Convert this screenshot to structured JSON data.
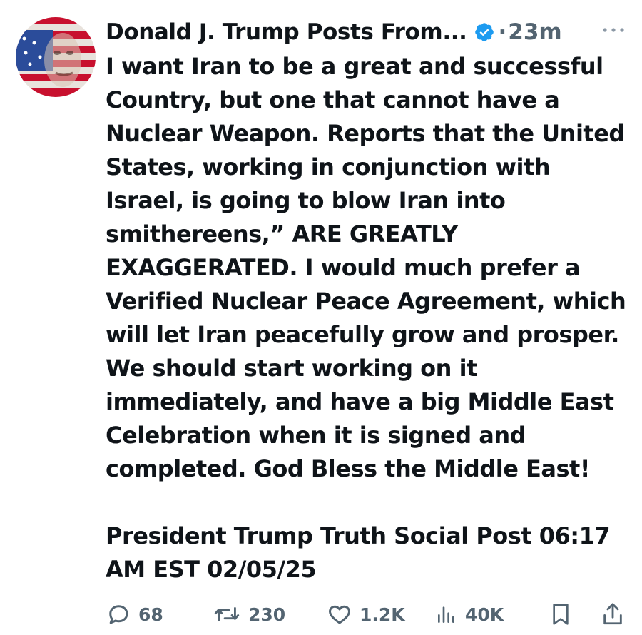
{
  "post": {
    "author": "Donald J. Trump Posts From...",
    "separator": "·",
    "time": "23m",
    "text": "I want Iran to be a great and successful Country, but one that cannot have a Nuclear Weapon. Reports that the United States, working in conjunction with Israel, is going to blow Iran into smithereens,” ARE GREATLY EXAGGERATED. I would much prefer a Verified Nuclear Peace Agreement, which will let Iran peacefully grow and prosper. We should start working on it immediately, and have a big Middle East Celebration when it is signed and completed. God Bless the Middle East!",
    "source_line": "President Trump Truth Social Post 06:17 AM EST 02/05/25"
  },
  "actions": {
    "replies": "68",
    "reposts": "230",
    "likes": "1.2K",
    "views": "40K"
  },
  "icons": {
    "verified": "verified-badge-icon",
    "more": "more-dots-icon",
    "reply": "reply-bubble-icon",
    "repost": "repost-arrows-icon",
    "like": "heart-icon",
    "views": "bar-chart-icon",
    "bookmark": "bookmark-icon",
    "share": "share-upload-icon"
  },
  "colors": {
    "text": "#0f1419",
    "muted": "#536471",
    "verified": "#1d9bf0",
    "flag_red": "#c8102e",
    "flag_blue": "#2b4c9a"
  }
}
